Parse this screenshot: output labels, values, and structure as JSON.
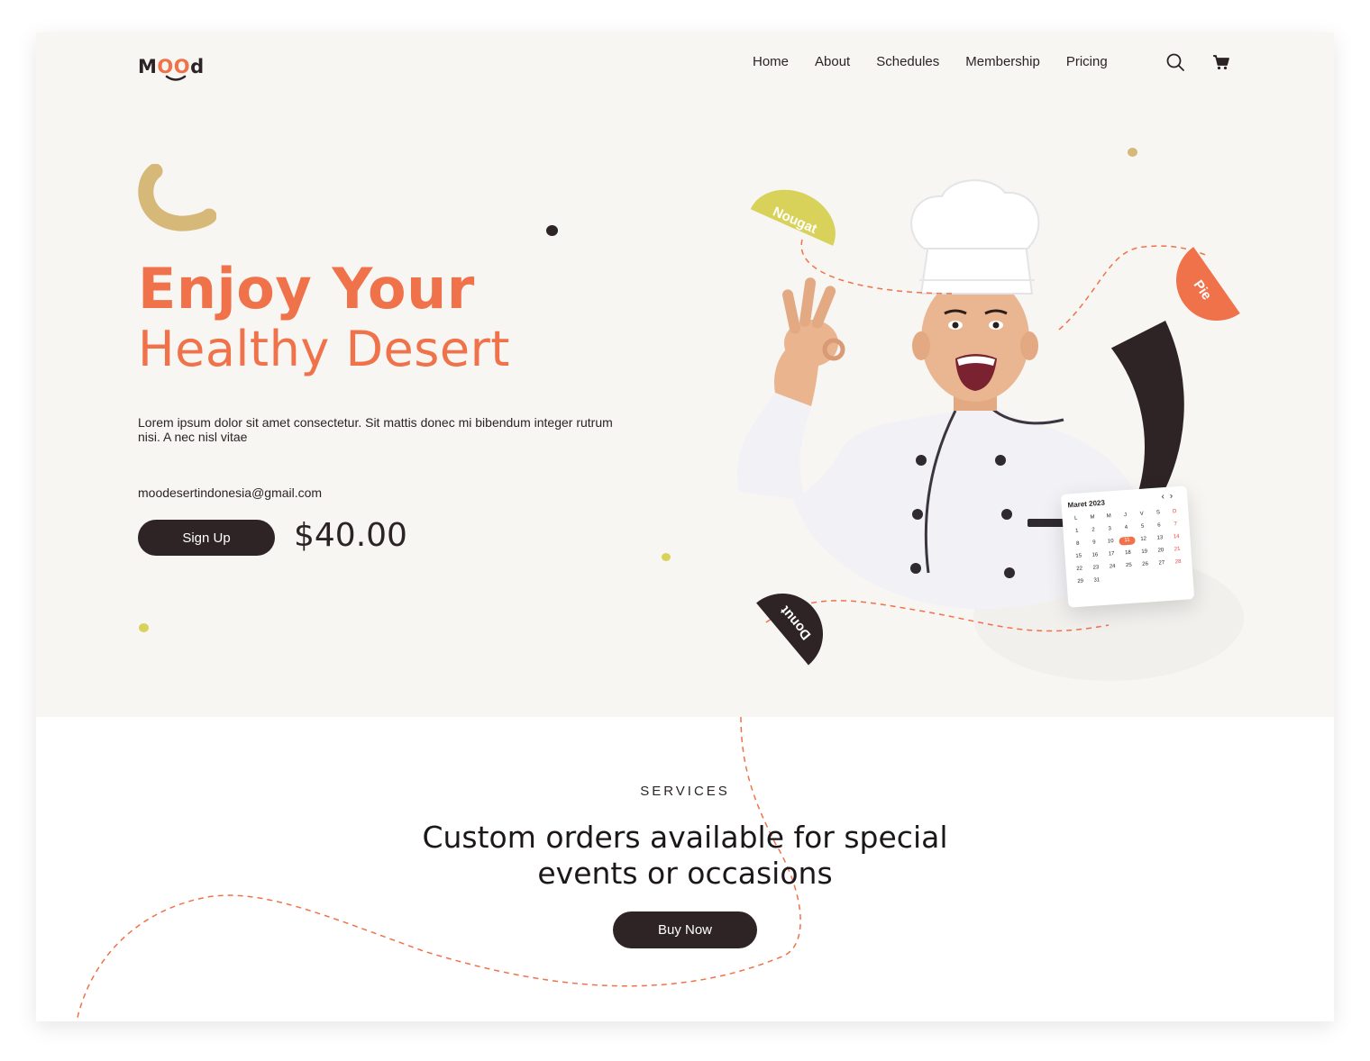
{
  "brand": {
    "logo_prefix": "M",
    "logo_oo": "OO",
    "logo_suffix": "d"
  },
  "nav": {
    "items": [
      "Home",
      "About",
      "Schedules",
      "Membership",
      "Pricing"
    ],
    "search_icon": "search-icon",
    "cart_icon": "cart-icon"
  },
  "hero": {
    "headline_line1": "Enjoy Your",
    "headline_line2": "Healthy Desert",
    "description": "Lorem ipsum dolor sit amet consectetur. Sit mattis donec mi bibendum integer rutrum nisi. A nec nisl vitae",
    "email": "moodesertindonesia@gmail.com",
    "signup_label": "Sign Up",
    "price": "$40.00"
  },
  "tags": {
    "nougat": "Nougat",
    "pie": "Pie",
    "donut": "Donut"
  },
  "calendar": {
    "title": "Maret 2023",
    "weekdays": [
      "L",
      "M",
      "M",
      "J",
      "V",
      "S",
      "D"
    ],
    "days": [
      "",
      "",
      "",
      "",
      "",
      "",
      "",
      "1",
      "2",
      "3",
      "4",
      "5",
      "6",
      "7",
      "8",
      "9",
      "10",
      "11",
      "12",
      "13",
      "14",
      "15",
      "16",
      "17",
      "18",
      "19",
      "20",
      "21",
      "22",
      "23",
      "24",
      "25",
      "26",
      "27",
      "28",
      "29",
      "31"
    ],
    "selected": "11"
  },
  "services": {
    "label": "SERVICES",
    "title": "Custom orders available for special events or occasions",
    "buy_label": "Buy Now"
  },
  "colors": {
    "accent": "#f0724a",
    "dark": "#2e2425",
    "yellow": "#d8d25a",
    "tan": "#d6b878",
    "hero_bg": "#f7f6f3"
  }
}
